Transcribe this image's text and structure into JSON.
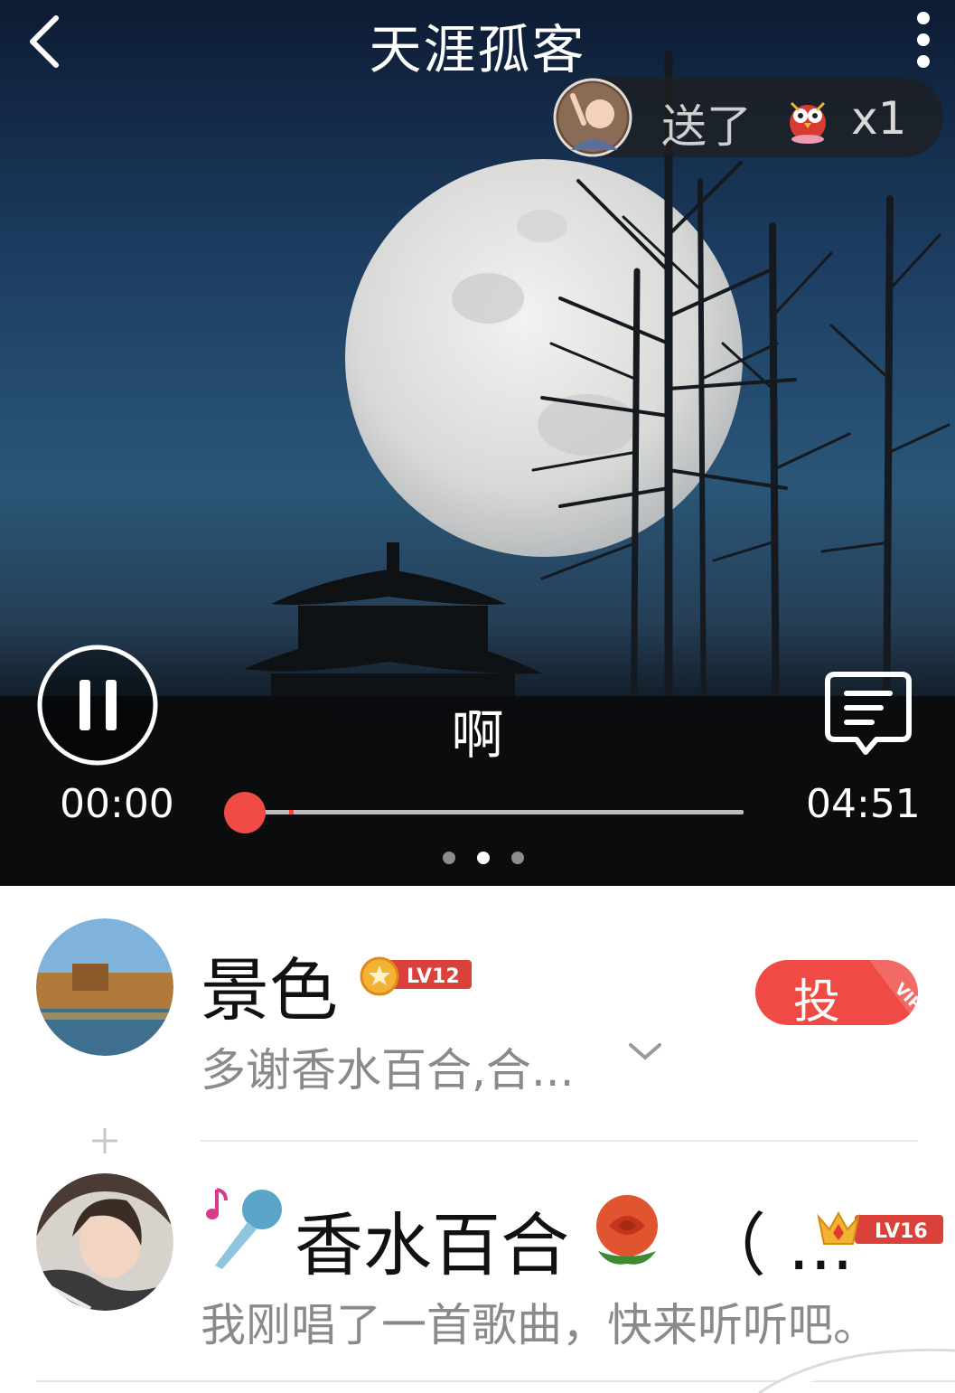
{
  "header": {
    "title": "天涯孤客"
  },
  "gift_notice": {
    "sent_label": "送了",
    "count": "x1",
    "gift_icon": "owl-gift-icon"
  },
  "player": {
    "lyric": "啊",
    "time_current": "00:00",
    "time_total": "04:51",
    "progress": 0.0,
    "page_count": 3,
    "page_active": 2
  },
  "comments": [
    {
      "name": "景色",
      "level": "LV12",
      "message": "多谢香水百合,合...",
      "vote_label": "投",
      "vip_label": "VIP"
    },
    {
      "name": "香水百合",
      "name_tail": "（ ...",
      "level": "LV16",
      "message": "我刚唱了一首歌曲，快来听听吧。"
    }
  ],
  "colors": {
    "accent": "#ef4a44",
    "muted_text": "#8a8a8a",
    "badge_red": "#d9413a",
    "badge_gold": "#f2b233"
  }
}
